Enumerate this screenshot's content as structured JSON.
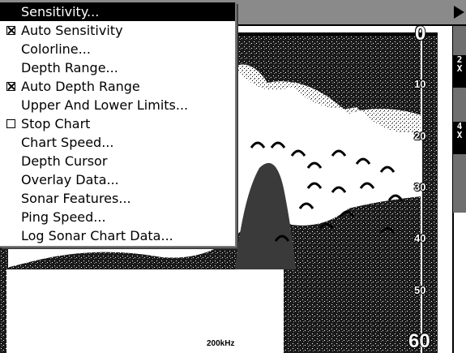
{
  "menu": {
    "items": [
      {
        "label": "Sensitivity...",
        "checkbox": null,
        "selected": true
      },
      {
        "label": "Auto Sensitivity",
        "checkbox": "checked",
        "selected": false
      },
      {
        "label": "Colorline...",
        "checkbox": null,
        "selected": false
      },
      {
        "label": "Depth Range...",
        "checkbox": null,
        "selected": false
      },
      {
        "label": "Auto Depth Range",
        "checkbox": "checked",
        "selected": false
      },
      {
        "label": "Upper And Lower Limits...",
        "checkbox": null,
        "selected": false
      },
      {
        "label": "Stop Chart",
        "checkbox": "unchecked",
        "selected": false
      },
      {
        "label": "Chart Speed...",
        "checkbox": null,
        "selected": false
      },
      {
        "label": "Depth Cursor",
        "checkbox": null,
        "selected": false
      },
      {
        "label": "Overlay Data...",
        "checkbox": null,
        "selected": false
      },
      {
        "label": "Sonar Features...",
        "checkbox": null,
        "selected": false
      },
      {
        "label": "Ping Speed...",
        "checkbox": null,
        "selected": false
      },
      {
        "label": "Log Sonar Chart Data...",
        "checkbox": null,
        "selected": false
      }
    ]
  },
  "depth_scale": {
    "labels": [
      "0",
      "10",
      "20",
      "30",
      "40",
      "50",
      "60"
    ]
  },
  "zoom": {
    "first": [
      "2",
      "X"
    ],
    "second": [
      "4",
      "X"
    ]
  },
  "frequency": "200kHz",
  "colors": {
    "menu_selected_bg": "#000000",
    "topbar": "#8a8a8a",
    "water": "#ffffff"
  }
}
